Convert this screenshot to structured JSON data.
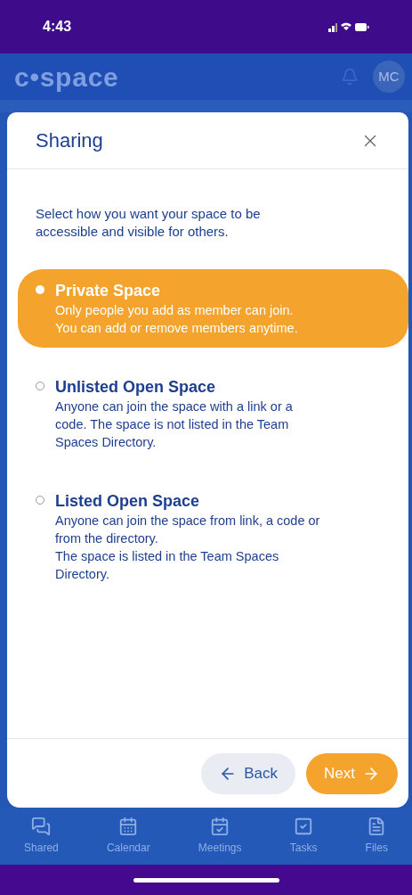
{
  "status_bar": {
    "time": "4:43"
  },
  "app_header": {
    "logo": "c•space",
    "avatar": "MC"
  },
  "dialog": {
    "title": "Sharing",
    "intro": "Select how you want your space to be accessible and visible for others.",
    "options": [
      {
        "title": "Private Space",
        "description": [
          "Only people you add as member can join.",
          "You can add or remove members anytime."
        ],
        "selected": true
      },
      {
        "title": "Unlisted Open Space",
        "description": [
          "Anyone can join the space with a link or a code. The space is not listed in the Team Spaces Directory."
        ],
        "selected": false
      },
      {
        "title": "Listed Open Space",
        "description": [
          "Anyone can join the space from link, a code or from the directory.",
          "The space is listed in the Team Spaces Directory."
        ],
        "selected": false
      }
    ],
    "buttons": [
      {
        "label": "Back",
        "kind": "secondary"
      },
      {
        "label": "Next",
        "kind": "primary"
      }
    ]
  },
  "bottom_nav": [
    {
      "label": "Shared"
    },
    {
      "label": "Calendar"
    },
    {
      "label": "Meetings"
    },
    {
      "label": "Tasks"
    },
    {
      "label": "Files"
    }
  ]
}
